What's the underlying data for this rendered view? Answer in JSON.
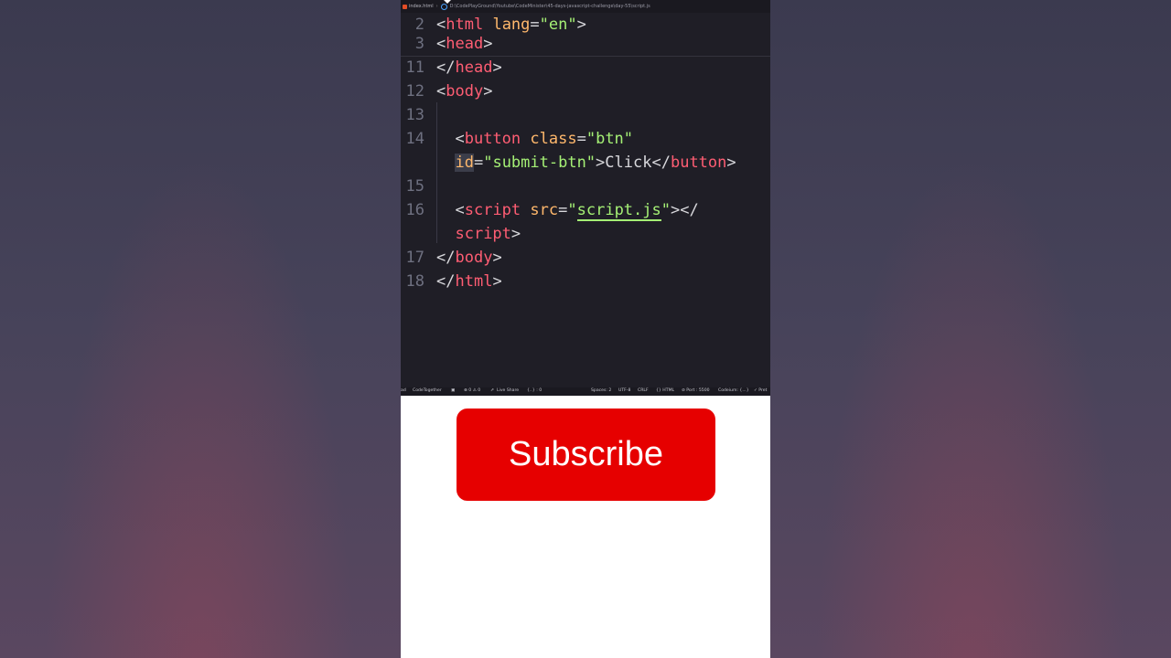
{
  "tab": {
    "file_name": "index.html",
    "path": "D:\\CodePlayGround\\Youtube\\CodeMinister\\45-days-javascript-challenge\\day-55\\script.js"
  },
  "code_lines": [
    {
      "num": "2",
      "parts": [
        [
          "punc",
          "<"
        ],
        [
          "tag",
          "html"
        ],
        [
          "txt",
          " "
        ],
        [
          "attr",
          "lang"
        ],
        [
          "punc",
          "="
        ],
        [
          "str",
          "\"en\""
        ],
        [
          "punc",
          ">"
        ]
      ]
    },
    {
      "num": "3",
      "parts": [
        [
          "punc",
          "<"
        ],
        [
          "tag",
          "head"
        ],
        [
          "punc",
          ">"
        ]
      ]
    },
    {
      "num": "11",
      "parts": [
        [
          "punc",
          "</"
        ],
        [
          "tag",
          "head"
        ],
        [
          "punc",
          ">"
        ]
      ]
    },
    {
      "num": "12",
      "parts": [
        [
          "punc",
          "<"
        ],
        [
          "tag",
          "body"
        ],
        [
          "punc",
          ">"
        ]
      ]
    },
    {
      "num": "13",
      "parts": []
    },
    {
      "num": "14",
      "parts": [
        [
          "txt",
          "  "
        ],
        [
          "punc",
          "<"
        ],
        [
          "tag",
          "button"
        ],
        [
          "txt",
          " "
        ],
        [
          "attr",
          "class"
        ],
        [
          "punc",
          "="
        ],
        [
          "str",
          "\"btn\""
        ]
      ]
    },
    {
      "num": "",
      "parts": [
        [
          "txt",
          "  "
        ],
        [
          "attr sel",
          "id"
        ],
        [
          "punc",
          "="
        ],
        [
          "str",
          "\"submit-btn\""
        ],
        [
          "punc",
          ">"
        ],
        [
          "txt",
          "Click"
        ],
        [
          "punc",
          "</"
        ],
        [
          "tag",
          "button"
        ],
        [
          "punc",
          ">"
        ]
      ]
    },
    {
      "num": "15",
      "parts": []
    },
    {
      "num": "16",
      "parts": [
        [
          "txt",
          "  "
        ],
        [
          "punc",
          "<"
        ],
        [
          "tag",
          "script"
        ],
        [
          "txt",
          " "
        ],
        [
          "attr",
          "src"
        ],
        [
          "punc",
          "="
        ],
        [
          "str",
          "\""
        ],
        [
          "str underline",
          "script.js"
        ],
        [
          "str",
          "\""
        ],
        [
          "punc",
          "></"
        ]
      ]
    },
    {
      "num": "",
      "parts": [
        [
          "txt",
          "  "
        ],
        [
          "tag",
          "script"
        ],
        [
          "punc",
          ">"
        ]
      ]
    },
    {
      "num": "17",
      "parts": [
        [
          "punc",
          "</"
        ],
        [
          "tag",
          "body"
        ],
        [
          "punc",
          ">"
        ]
      ]
    },
    {
      "num": "18",
      "parts": [
        [
          "punc",
          "</"
        ],
        [
          "tag",
          "html"
        ],
        [
          "punc",
          ">"
        ]
      ]
    }
  ],
  "status": {
    "left_cut": "ad",
    "codetogether": "CodeTogether",
    "problems": "⊗ 0 ⚠ 0",
    "live_share": "Live Share",
    "cursor": "{..} : 0",
    "spaces": "Spaces: 2",
    "encoding": "UTF-8",
    "eol": "CRLF",
    "language": "{} HTML",
    "port": "⊘ Port : 5500",
    "codeium": "Codeium: {...}",
    "prettier": "✓ Pret"
  },
  "subscribe_label": "Subscribe"
}
